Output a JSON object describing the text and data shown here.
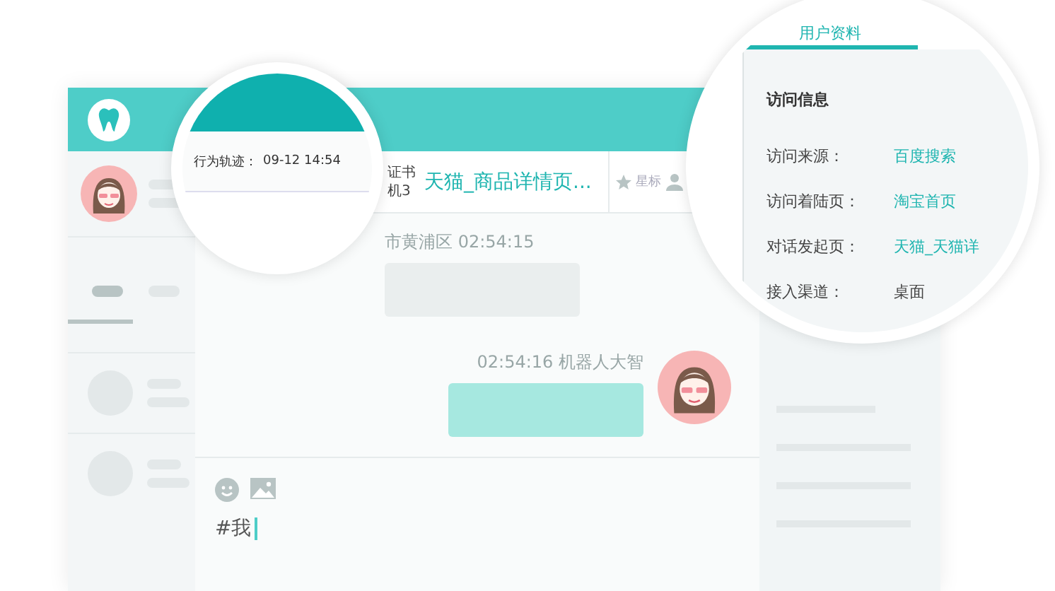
{
  "sidebar": {
    "tabs": [
      {
        "selected": true
      },
      {
        "selected": false
      }
    ]
  },
  "conversation": {
    "snippet_lines": [
      "证书",
      "机3"
    ],
    "source_link": "天猫_商品详情页...",
    "star_button": "星标"
  },
  "messages": [
    {
      "kind": "incoming",
      "meta": "市黄浦区 02:54:15"
    },
    {
      "kind": "outgoing",
      "meta": "02:54:16  机器人大智"
    }
  ],
  "composer": {
    "value": "#我"
  },
  "left_magnifier": {
    "label": "行为轨迹：",
    "value": "09-12 14:54"
  },
  "right_magnifier": {
    "tabs": [
      {
        "label": "用户资料",
        "selected": true
      }
    ],
    "section_title": "访问信息",
    "rows": [
      {
        "label": "访问来源：",
        "value": "百度搜索",
        "kind": "link"
      },
      {
        "label": "访问着陆页：",
        "value": "淘宝首页",
        "kind": "link"
      },
      {
        "label": "对话发起页：",
        "value": "天猫_天猫详",
        "kind": "link"
      },
      {
        "label": "接入渠道：",
        "value": "桌面",
        "kind": "plain"
      }
    ]
  }
}
